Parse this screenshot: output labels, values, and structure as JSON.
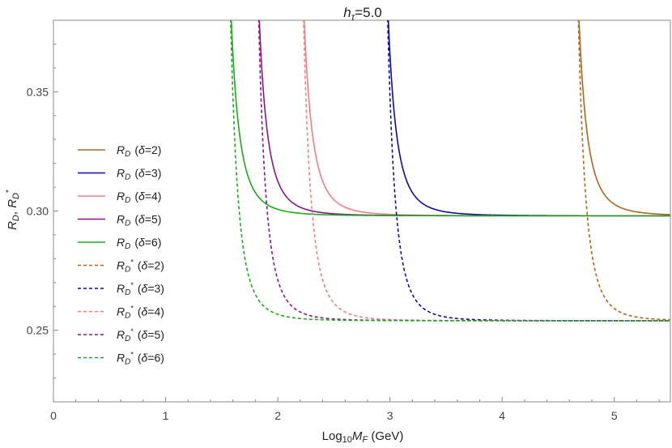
{
  "chart_data": {
    "type": "line",
    "title": {
      "base": "h",
      "sub": "τ",
      "rest": "=5.0"
    },
    "xlabel": {
      "pre": "Log",
      "sub10": "10",
      "var": "M",
      "varsub": "F",
      "post": " (GeV)"
    },
    "ylabel": {
      "a": "R",
      "asub": "D",
      "sep": ", ",
      "b": "R",
      "bsub": "D",
      "bsup": "*"
    },
    "xlim": [
      0,
      5.5
    ],
    "ylim": [
      0.22,
      0.38
    ],
    "xticks": [
      "0",
      "1",
      "2",
      "3",
      "4",
      "5"
    ],
    "xtick_values": [
      0,
      1,
      2,
      3,
      4,
      5
    ],
    "yticks": [
      "0.25",
      "0.30",
      "0.35"
    ],
    "ytick_values": [
      0.25,
      0.3,
      0.35
    ],
    "legend_position": "left",
    "series": [
      {
        "name": "R_D (δ=2)",
        "label_main": "R",
        "label_sub": "D",
        "label_sup": "",
        "label_delta": "δ",
        "label_val": "=2",
        "color": "#b2651c",
        "dash": false,
        "x0": 4.4,
        "asymptote": 0.298,
        "amp": 0.0007,
        "k": 3.8,
        "x": [
          4.4,
          4.45,
          4.5,
          4.6,
          4.7,
          4.8,
          4.9,
          5.0,
          5.1,
          5.2,
          5.3,
          5.4,
          5.5
        ],
        "y": [
          0.3899,
          0.3813,
          0.3627,
          0.3388,
          0.3227,
          0.3131,
          0.3072,
          0.3036,
          0.3014,
          0.3001,
          0.2994,
          0.2988,
          0.2985
        ]
      },
      {
        "name": "R_D (δ=3)",
        "label_main": "R",
        "label_sub": "D",
        "label_sup": "",
        "label_delta": "δ",
        "label_val": "=3",
        "color": "#0c0ca6",
        "dash": false,
        "x0": 2.7,
        "asymptote": 0.298,
        "amp": 0.0007,
        "k": 3.8,
        "x": [
          2.83,
          2.9,
          3.0,
          3.1,
          3.2,
          3.3,
          3.4,
          3.5,
          3.6,
          3.7,
          3.8,
          3.9,
          4.0
        ],
        "y": [
          0.379,
          0.3465,
          0.3225,
          0.3109,
          0.3038,
          0.3011,
          0.2998,
          0.2991,
          0.2986,
          0.2983,
          0.2981,
          0.298,
          0.298
        ]
      },
      {
        "name": "R_D (δ=4)",
        "label_main": "R",
        "label_sub": "D",
        "label_sup": "",
        "label_delta": "δ",
        "label_val": "=4",
        "color": "#f08080",
        "dash": false,
        "x0": 1.95,
        "asymptote": 0.298,
        "amp": 0.0007,
        "k": 3.8,
        "x": [
          2.05,
          2.1,
          2.2,
          2.3,
          2.4,
          2.5,
          2.6,
          2.7,
          2.8,
          2.9,
          3.0
        ],
        "y": [
          0.38,
          0.36,
          0.32,
          0.3087,
          0.3021,
          0.3,
          0.299,
          0.2985,
          0.2982,
          0.298,
          0.298
        ]
      },
      {
        "name": "R_D (δ=5)",
        "label_main": "R",
        "label_sub": "D",
        "label_sup": "",
        "label_delta": "δ",
        "label_val": "=5",
        "color": "#8b158b",
        "dash": false,
        "x0": 1.55,
        "asymptote": 0.298,
        "amp": 0.0007,
        "k": 3.8,
        "x": [
          1.63,
          1.7,
          1.8,
          1.9,
          2.0,
          2.1,
          2.2,
          2.3,
          2.4
        ],
        "y": [
          0.38,
          0.3373,
          0.31,
          0.302,
          0.2997,
          0.2988,
          0.2984,
          0.2981,
          0.298
        ]
      },
      {
        "name": "R_D (δ=6)",
        "label_main": "R",
        "label_sub": "D",
        "label_sup": "",
        "label_delta": "δ",
        "label_val": "=6",
        "color": "#1aac1a",
        "dash": false,
        "x0": 1.3,
        "asymptote": 0.298,
        "amp": 0.0007,
        "k": 3.8,
        "x": [
          1.38,
          1.4,
          1.5,
          1.6,
          1.7,
          1.8,
          1.9,
          2.0,
          5.5
        ],
        "y": [
          0.38,
          0.342,
          0.309,
          0.301,
          0.299,
          0.2984,
          0.2981,
          0.298,
          0.298
        ]
      },
      {
        "name": "R_D* (δ=2)",
        "label_main": "R",
        "label_sub": "D",
        "label_sup": "*",
        "label_delta": "δ",
        "label_val": "=2",
        "color": "#b2651c",
        "dash": true,
        "x0": 4.4,
        "asymptote": 0.254,
        "amp": 0.0006,
        "k": 4.2,
        "x": [
          4.35,
          4.4,
          4.45,
          4.5,
          4.55,
          4.6,
          4.7,
          4.8,
          4.9,
          5.0,
          5.1,
          5.2,
          5.3,
          5.4,
          5.5
        ],
        "y": [
          0.38,
          0.36,
          0.33,
          0.31,
          0.295,
          0.285,
          0.272,
          0.2645,
          0.2605,
          0.258,
          0.2565,
          0.2556,
          0.255,
          0.2546,
          0.2544
        ]
      },
      {
        "name": "R_D* (δ=3)",
        "label_main": "R",
        "label_sub": "D",
        "label_sup": "*",
        "label_delta": "δ",
        "label_val": "=3",
        "color": "#0c0ca6",
        "dash": true,
        "x0": 2.7,
        "asymptote": 0.254,
        "amp": 0.0006,
        "k": 4.2,
        "x": [
          2.7,
          2.75,
          2.8,
          2.85,
          2.9,
          3.0,
          3.1,
          3.2,
          3.3,
          3.4,
          3.5,
          3.6,
          3.8,
          4.0
        ],
        "y": [
          0.38,
          0.355,
          0.325,
          0.305,
          0.29,
          0.273,
          0.264,
          0.2595,
          0.257,
          0.2555,
          0.2548,
          0.2544,
          0.2541,
          0.254
        ]
      },
      {
        "name": "R_D* (δ=4)",
        "label_main": "R",
        "label_sub": "D",
        "label_sup": "*",
        "label_delta": "δ",
        "label_val": "=4",
        "color": "#f08080",
        "dash": true,
        "x0": 1.95,
        "asymptote": 0.254,
        "amp": 0.0006,
        "k": 4.2,
        "x": [
          1.98,
          2.0,
          2.05,
          2.1,
          2.15,
          2.2,
          2.3,
          2.4,
          2.5,
          2.6,
          2.8,
          3.0
        ],
        "y": [
          0.38,
          0.35,
          0.31,
          0.29,
          0.278,
          0.27,
          0.262,
          0.258,
          0.256,
          0.255,
          0.2543,
          0.2541
        ]
      },
      {
        "name": "R_D* (δ=5)",
        "label_main": "R",
        "label_sub": "D",
        "label_sup": "*",
        "label_delta": "δ",
        "label_val": "=5",
        "color": "#8b158b",
        "dash": true,
        "x0": 1.55,
        "asymptote": 0.254,
        "amp": 0.0006,
        "k": 4.2,
        "x": [
          1.57,
          1.6,
          1.65,
          1.7,
          1.75,
          1.8,
          1.9,
          2.0,
          2.1,
          2.2,
          2.4
        ],
        "y": [
          0.38,
          0.34,
          0.3,
          0.28,
          0.268,
          0.262,
          0.257,
          0.2552,
          0.2545,
          0.2542,
          0.254
        ]
      },
      {
        "name": "R_D* (δ=6)",
        "label_main": "R",
        "label_sub": "D",
        "label_sup": "*",
        "label_delta": "δ",
        "label_val": "=6",
        "color": "#1aac1a",
        "dash": true,
        "x0": 1.3,
        "asymptote": 0.254,
        "amp": 0.0006,
        "k": 4.2,
        "x": [
          1.3,
          1.35,
          1.4,
          1.45,
          1.5,
          1.6,
          1.7,
          1.8,
          1.9,
          2.0,
          2.2
        ],
        "y": [
          0.38,
          0.33,
          0.28,
          0.265,
          0.259,
          0.2555,
          0.2545,
          0.2542,
          0.2541,
          0.254,
          0.254
        ]
      }
    ]
  }
}
